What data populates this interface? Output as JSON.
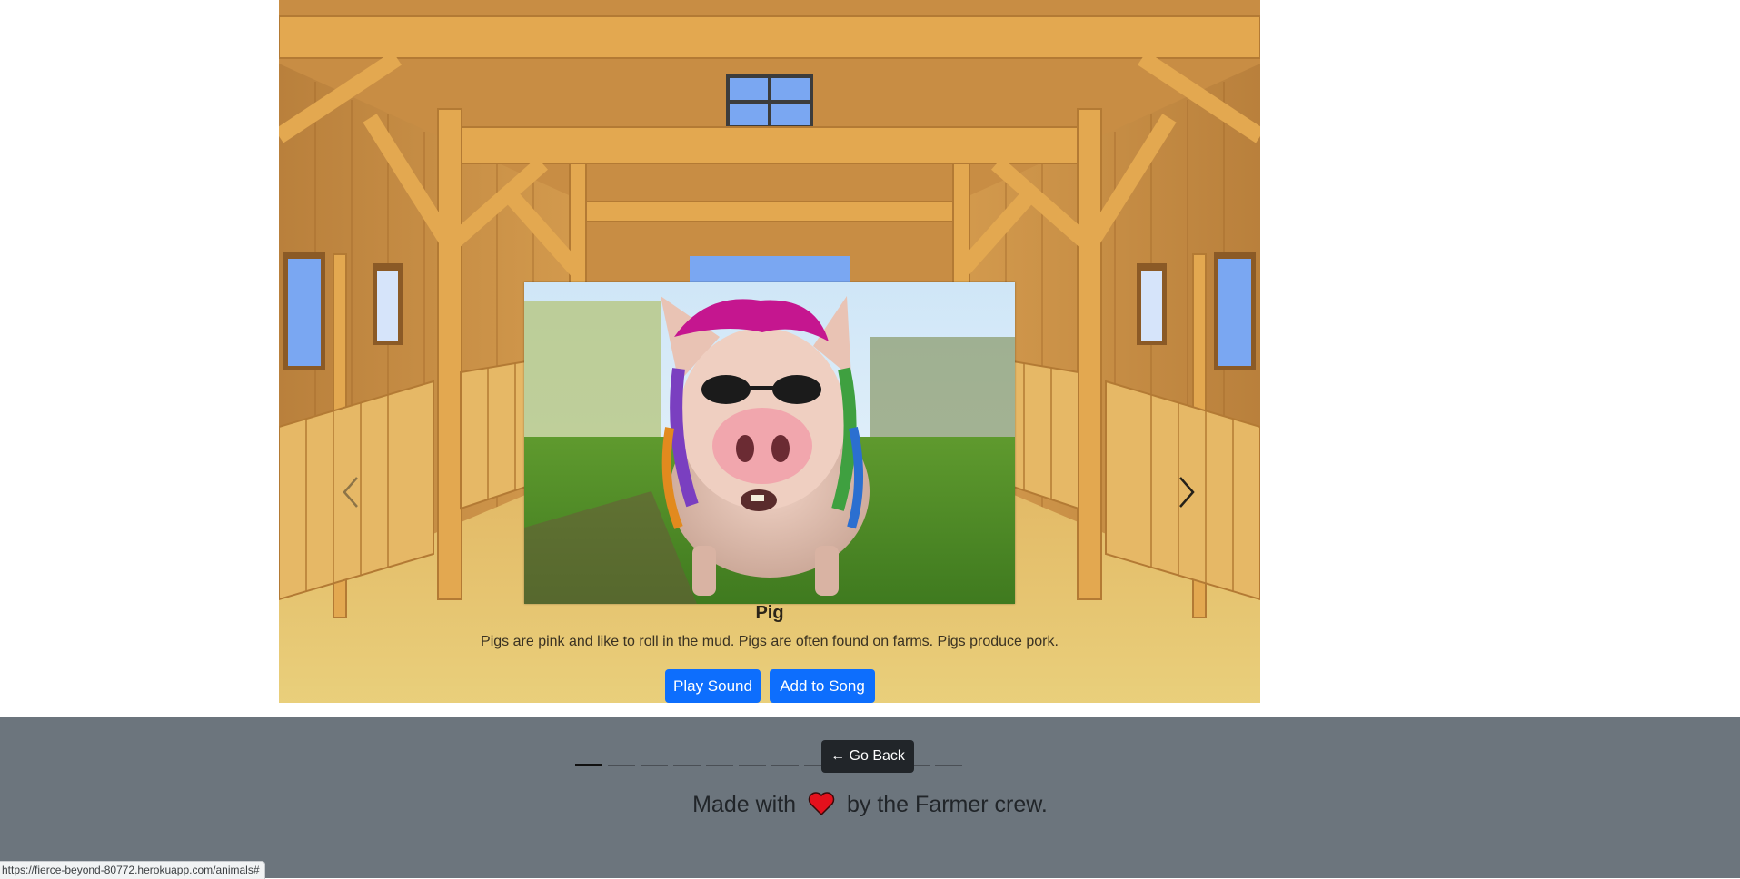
{
  "carousel": {
    "slide": {
      "image": "pig-photo",
      "title": "Pig",
      "description": "Pigs are pink and like to roll in the mud. Pigs are often found on farms. Pigs produce pork."
    },
    "buttons": {
      "play": "Play Sound",
      "add": "Add to Song"
    },
    "controls": {
      "prev_icon": "chevron-left-icon",
      "next_icon": "chevron-right-icon"
    },
    "indicators": {
      "count": 12,
      "active_index": 0
    }
  },
  "footer": {
    "go_back": "← Go Back",
    "made_with_prefix": "Made with",
    "made_with_suffix": "by the Farmer crew.",
    "heart_icon": "heart-icon"
  },
  "status_bar": {
    "url": "https://fierce-beyond-80772.herokuapp.com/animals#"
  },
  "colors": {
    "primary_button": "#0d6efd",
    "footer_bg": "#6c757d",
    "go_back_bg": "#212529",
    "heart": "#e4101c"
  }
}
